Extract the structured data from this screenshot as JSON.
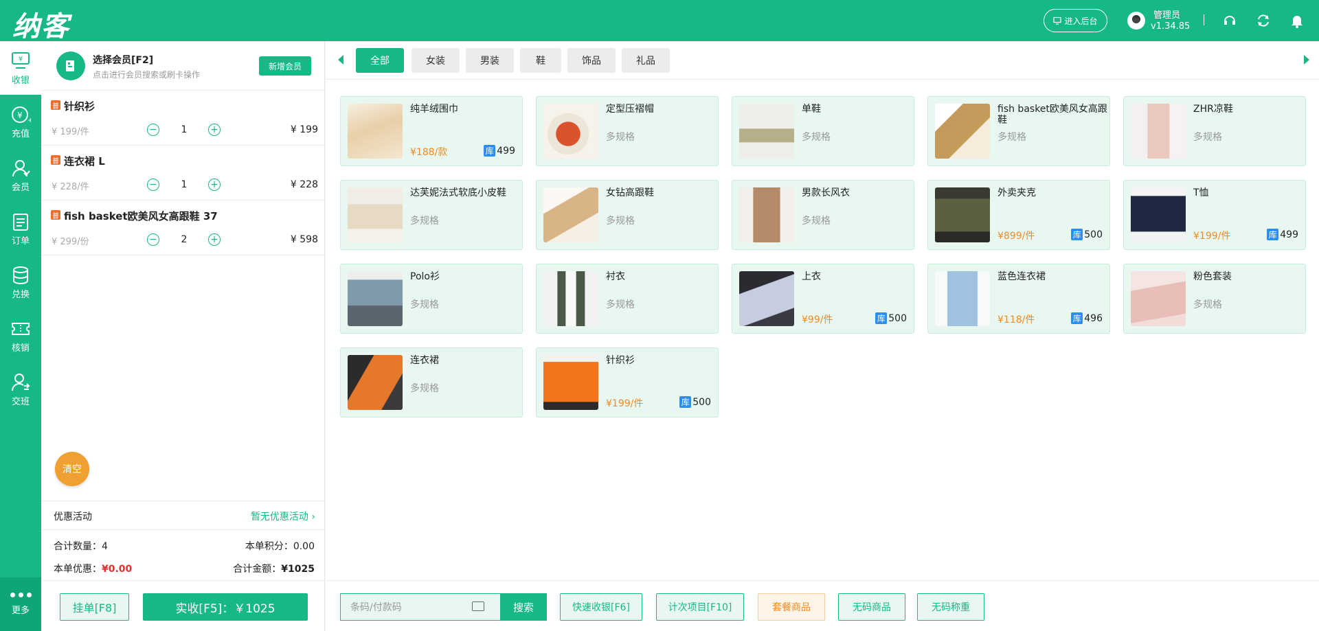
{
  "header": {
    "logo": "纳客",
    "admin_button": "进入后台",
    "user_name": "管理员",
    "version": "v1.34.85"
  },
  "nav": {
    "items": [
      {
        "label": "收银",
        "icon": "cashier-icon"
      },
      {
        "label": "充值",
        "icon": "recharge-icon"
      },
      {
        "label": "会员",
        "icon": "member-icon"
      },
      {
        "label": "订单",
        "icon": "order-icon"
      },
      {
        "label": "兑换",
        "icon": "exchange-icon"
      },
      {
        "label": "核销",
        "icon": "ticket-icon"
      },
      {
        "label": "交班",
        "icon": "handover-icon"
      }
    ],
    "more": "更多"
  },
  "member": {
    "title": "选择会员[F2]",
    "subtitle": "点击进行会员搜索或刷卡操作",
    "new_button": "新增会员"
  },
  "cart": {
    "items": [
      {
        "badge": "普",
        "name": "针织衫",
        "unit_price": "¥ 199/件",
        "qty": "1",
        "total": "¥ 199"
      },
      {
        "badge": "普",
        "name": "连衣裙 L",
        "unit_price": "¥ 228/件",
        "qty": "1",
        "total": "¥ 228"
      },
      {
        "badge": "普",
        "name": "fish basket欧美风女高跟鞋 37",
        "unit_price": "¥ 299/份",
        "qty": "2",
        "total": "¥ 598"
      }
    ],
    "clear_button": "清空",
    "promo_label": "优惠活动",
    "promo_value": "暂无优惠活动",
    "total_qty_label": "合计数量：",
    "total_qty": "4",
    "points_label": "本单积分：",
    "points": "0.00",
    "discount_label": "本单优惠：",
    "discount": "¥0.00",
    "amount_label": "合计金额：",
    "amount": "¥1025",
    "hold_button": "挂单[F8]",
    "pay_button": "实收[F5]：￥1025"
  },
  "tabs": [
    "全部",
    "女装",
    "男装",
    "鞋",
    "饰品",
    "礼品"
  ],
  "products": [
    {
      "name": "纯羊绒围巾",
      "price": "¥188/款",
      "stock": "499",
      "thumb": "th-scarf"
    },
    {
      "name": "定型压褶帽",
      "multi": "多规格",
      "thumb": "th-hat"
    },
    {
      "name": "单鞋",
      "multi": "多规格",
      "thumb": "th-shoe1"
    },
    {
      "name": "fish basket欧美风女高跟鞋",
      "multi": "多规格",
      "thumb": "th-heels"
    },
    {
      "name": "ZHR凉鞋",
      "multi": "多规格",
      "thumb": "th-sandal"
    },
    {
      "name": "达芙妮法式软底小皮鞋",
      "multi": "多规格",
      "thumb": "th-loafer"
    },
    {
      "name": "女钻高跟鞋",
      "multi": "多规格",
      "thumb": "th-diamond"
    },
    {
      "name": "男款长风衣",
      "multi": "多规格",
      "thumb": "th-coat"
    },
    {
      "name": "外卖夹克",
      "price": "¥899/件",
      "stock": "500",
      "thumb": "th-jacket"
    },
    {
      "name": "T恤",
      "price": "¥199/件",
      "stock": "499",
      "thumb": "th-tee"
    },
    {
      "name": "Polo衫",
      "multi": "多规格",
      "thumb": "th-polo"
    },
    {
      "name": "衬衣",
      "multi": "多规格",
      "thumb": "th-shirt"
    },
    {
      "name": "上衣",
      "price": "¥99/件",
      "stock": "500",
      "thumb": "th-top"
    },
    {
      "name": "蓝色连衣裙",
      "price": "¥118/件",
      "stock": "496",
      "thumb": "th-dress"
    },
    {
      "name": "粉色套装",
      "multi": "多规格",
      "thumb": "th-pink"
    },
    {
      "name": "连衣裙",
      "multi": "多规格",
      "thumb": "th-orangedress"
    },
    {
      "name": "针织衫",
      "price": "¥199/件",
      "stock": "500",
      "thumb": "th-cardigan"
    }
  ],
  "stock_badge": "库",
  "bottom": {
    "search_placeholder": "条码/付款码",
    "search_button": "搜索",
    "buttons": [
      {
        "label": "快速收银[F6]",
        "style": "green"
      },
      {
        "label": "计次项目[F10]",
        "style": "green"
      },
      {
        "label": "套餐商品",
        "style": "orange"
      },
      {
        "label": "无码商品",
        "style": "green"
      },
      {
        "label": "无码称重",
        "style": "green"
      }
    ]
  },
  "colors": {
    "primary": "#16b885",
    "orange": "#f08a24",
    "stock_blue": "#2b8ef0",
    "red": "#e53030"
  }
}
